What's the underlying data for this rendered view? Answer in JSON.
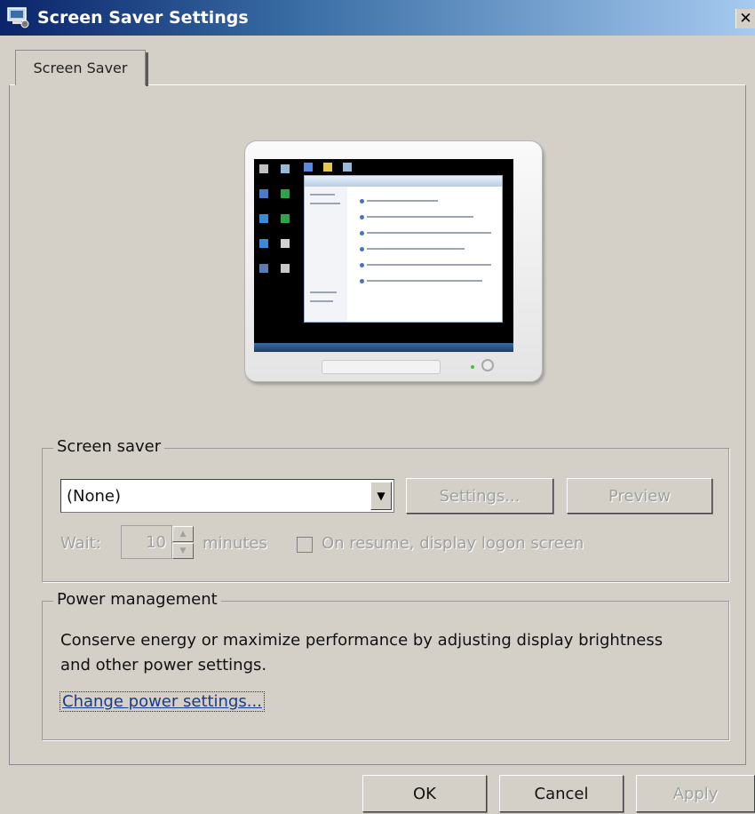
{
  "window": {
    "title": "Screen Saver Settings",
    "close_glyph": "✕"
  },
  "tabs": [
    {
      "label": "Screen Saver"
    }
  ],
  "screen_saver": {
    "group_label": "Screen saver",
    "selected": "(None)",
    "dropdown_glyph": "▼",
    "settings_label": "Settings...",
    "preview_label": "Preview",
    "wait_label": "Wait:",
    "wait_value": "10",
    "minutes_label": "minutes",
    "resume_label": "On resume, display logon screen",
    "resume_checked": false
  },
  "power": {
    "group_label": "Power management",
    "description": "Conserve energy or maximize performance by adjusting display brightness and other power settings.",
    "link_label": "Change power settings..."
  },
  "buttons": {
    "ok": "OK",
    "cancel": "Cancel",
    "apply": "Apply"
  },
  "icons": {
    "title": "screen-saver-icon",
    "close": "close-icon",
    "dropdown": "chevron-down-icon",
    "spin_up": "spin-up-icon",
    "spin_down": "spin-down-icon"
  }
}
